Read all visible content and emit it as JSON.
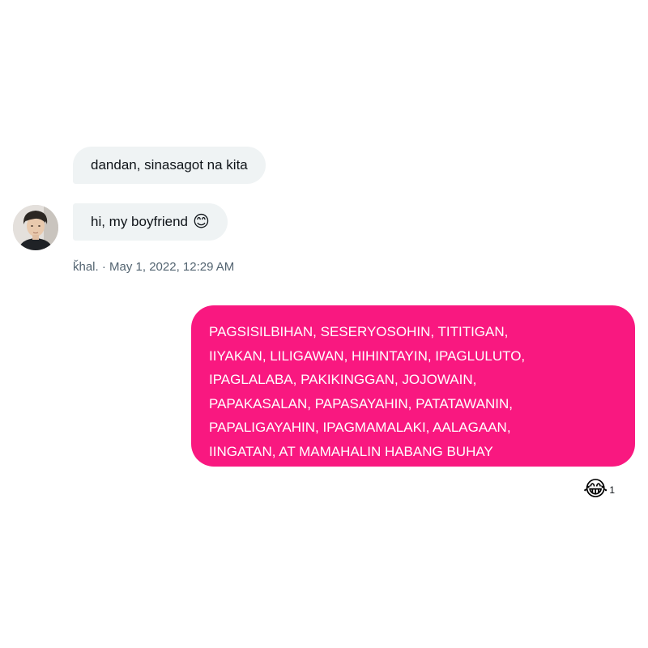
{
  "conversation": {
    "incoming_messages": [
      {
        "text": "dandan, sinasagot na kita"
      },
      {
        "text": "hi, my boyfriend",
        "emoji": "😊",
        "emoji_name": "smiling-face-icon"
      }
    ],
    "meta": {
      "sender": "ǩhal.",
      "separator": " · ",
      "timestamp": "May 1, 2022, 12:29 AM"
    },
    "outgoing_message": {
      "lines": [
        "PAGSISILBIHAN, SESERYOSOHIN, TITITIGAN,",
        "IIYAKAN, LILIGAWAN, HIHINTAYIN, IPAGLULUTO,",
        "IPAGLALABA, PAKIKINGGAN, JOJOWAIN,",
        "PAPAKASALAN, PAPASAYAHIN, PATATAWANIN,",
        "PAPALIGAYAHIN, IPAGMAMALAKI, AALAGAAN,",
        "IINGATAN, AT MAMAHALIN HABANG BUHAY"
      ]
    },
    "reaction": {
      "emoji": "😂",
      "emoji_name": "tears-of-joy-icon",
      "count": "1"
    }
  },
  "colors": {
    "incoming_bubble": "#eff3f4",
    "outgoing_bubble": "#f91880",
    "meta_text": "#536471"
  }
}
